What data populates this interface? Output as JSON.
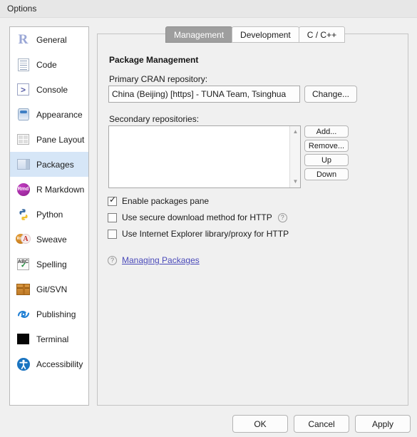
{
  "window": {
    "title": "Options"
  },
  "sidebar": {
    "items": [
      {
        "label": "General",
        "icon": "r-logo-icon",
        "selected": false
      },
      {
        "label": "Code",
        "icon": "code-document-icon",
        "selected": false
      },
      {
        "label": "Console",
        "icon": "console-prompt-icon",
        "selected": false
      },
      {
        "label": "Appearance",
        "icon": "paint-bucket-icon",
        "selected": false
      },
      {
        "label": "Pane Layout",
        "icon": "pane-grid-icon",
        "selected": false
      },
      {
        "label": "Packages",
        "icon": "package-box-icon",
        "selected": true
      },
      {
        "label": "R Markdown",
        "icon": "rmd-badge-icon",
        "selected": false
      },
      {
        "label": "Python",
        "icon": "python-logo-icon",
        "selected": false
      },
      {
        "label": "Sweave",
        "icon": "sweave-pdf-icon",
        "selected": false
      },
      {
        "label": "Spelling",
        "icon": "spellcheck-abc-icon",
        "selected": false
      },
      {
        "label": "Git/SVN",
        "icon": "git-box-icon",
        "selected": false
      },
      {
        "label": "Publishing",
        "icon": "publishing-icon",
        "selected": false
      },
      {
        "label": "Terminal",
        "icon": "terminal-icon",
        "selected": false
      },
      {
        "label": "Accessibility",
        "icon": "accessibility-icon",
        "selected": false
      }
    ]
  },
  "tabs": [
    {
      "label": "Management",
      "active": true
    },
    {
      "label": "Development",
      "active": false
    },
    {
      "label": "C / C++",
      "active": false
    }
  ],
  "main": {
    "section_title": "Package Management",
    "cran": {
      "label": "Primary CRAN repository:",
      "value": "China (Beijing) [https] - TUNA Team, Tsinghua",
      "change_button": "Change..."
    },
    "secondary": {
      "label": "Secondary repositories:",
      "items": [],
      "buttons": {
        "add": "Add...",
        "remove": "Remove...",
        "up": "Up",
        "down": "Down"
      },
      "scroll_up_glyph": "▲",
      "scroll_down_glyph": "▼"
    },
    "checkboxes": [
      {
        "label": "Enable packages pane",
        "checked": true,
        "help": false
      },
      {
        "label": "Use secure download method for HTTP",
        "checked": false,
        "help": true
      },
      {
        "label": "Use Internet Explorer library/proxy for HTTP",
        "checked": false,
        "help": false
      }
    ],
    "help_link": {
      "glyph": "?",
      "label": "Managing Packages"
    }
  },
  "footer": {
    "ok": "OK",
    "cancel": "Cancel",
    "apply": "Apply"
  },
  "icon_glyphs": {
    "r_logo": "R",
    "console_prompt": ">",
    "rmd_badge": "Rmd",
    "sweave_rnw": "Rnw",
    "sweave_pdf": "A",
    "spelling_abc": "ABC",
    "help": "?"
  },
  "colors": {
    "selected_sidebar": "#d6e6f7",
    "active_tab": "#9e9e9e",
    "link": "#4a4ab9",
    "titlebar": "#e7e7e7",
    "dialog_bg": "#f0f0f0"
  }
}
